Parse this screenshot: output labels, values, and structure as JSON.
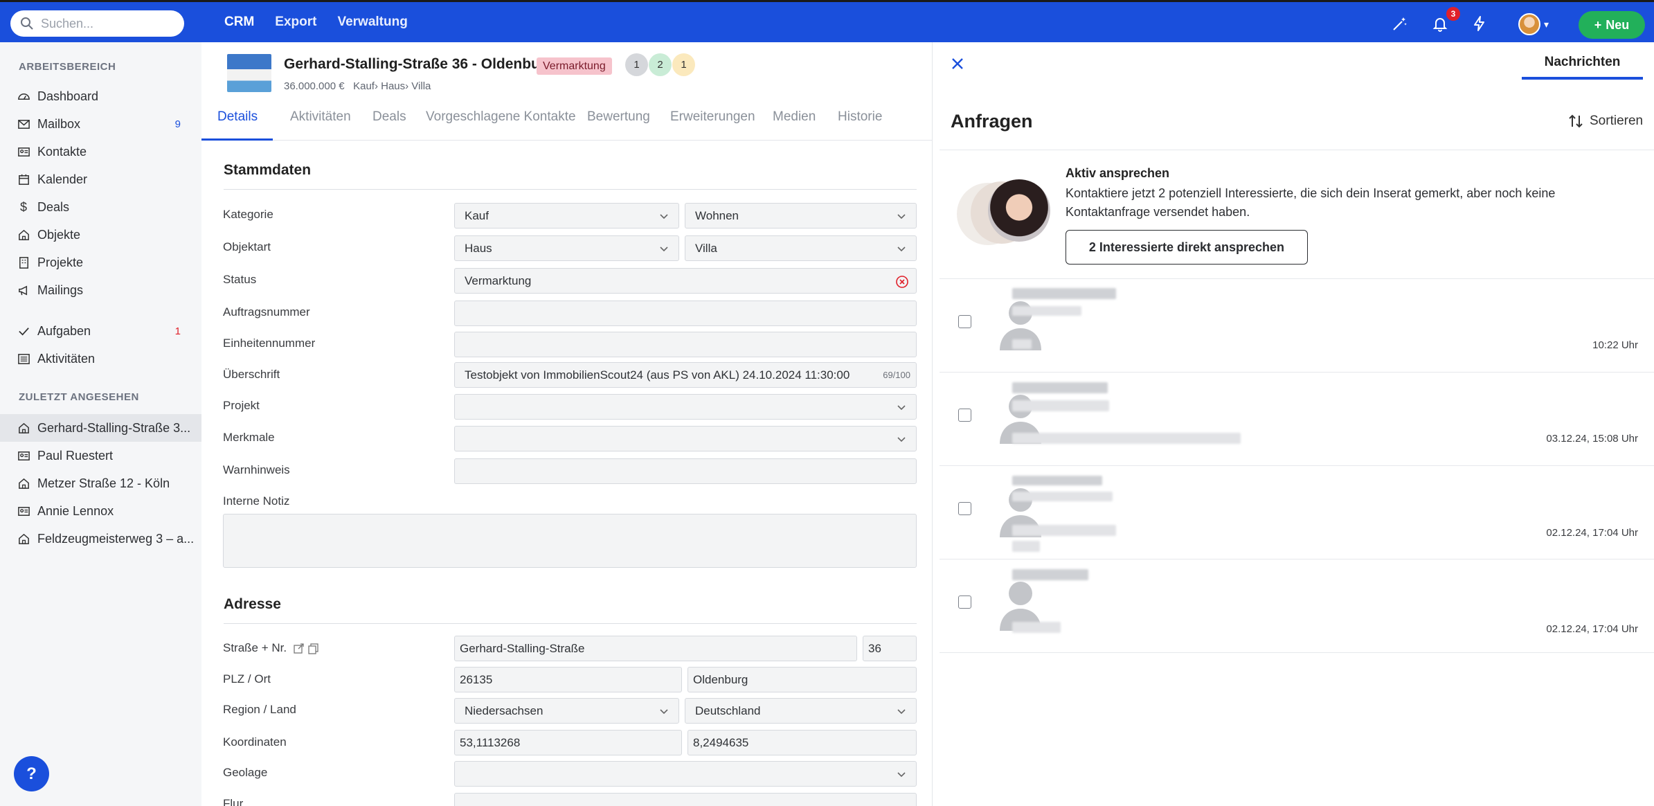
{
  "topbar": {
    "search_placeholder": "Suchen...",
    "nav": [
      "CRM",
      "Export",
      "Verwaltung"
    ],
    "notification_count": "3",
    "new_label": "Neu",
    "colors": {
      "primary": "#1a4fdc",
      "new_button": "#22b05a",
      "badge": "#e0202a"
    }
  },
  "sidebar": {
    "workspace_heading": "ARBEITSBEREICH",
    "items": [
      {
        "label": "Dashboard",
        "icon": "dashboard-icon",
        "count": ""
      },
      {
        "label": "Mailbox",
        "icon": "mail-icon",
        "count": "9"
      },
      {
        "label": "Kontakte",
        "icon": "contact-card-icon",
        "count": ""
      },
      {
        "label": "Kalender",
        "icon": "calendar-icon",
        "count": ""
      },
      {
        "label": "Deals",
        "icon": "dollar-icon",
        "count": ""
      },
      {
        "label": "Objekte",
        "icon": "house-icon",
        "count": ""
      },
      {
        "label": "Projekte",
        "icon": "building-icon",
        "count": ""
      },
      {
        "label": "Mailings",
        "icon": "megaphone-icon",
        "count": ""
      }
    ],
    "tasks": [
      {
        "label": "Aufgaben",
        "icon": "check-icon",
        "count": "1"
      },
      {
        "label": "Aktivitäten",
        "icon": "list-icon",
        "count": ""
      }
    ],
    "recent_heading": "ZULETZT ANGESEHEN",
    "recent": [
      {
        "label": "Gerhard-Stalling-Straße 3...",
        "icon": "house-icon"
      },
      {
        "label": "Paul Ruestert",
        "icon": "contact-card-icon"
      },
      {
        "label": "Metzer Straße 12 - Köln",
        "icon": "house-icon"
      },
      {
        "label": "Annie Lennox",
        "icon": "contact-card-icon"
      },
      {
        "label": "Feldzeugmeisterweg 3 – a...",
        "icon": "house-icon"
      }
    ],
    "help_label": "?"
  },
  "property": {
    "title": "Gerhard-Stalling-Straße 36 - Oldenburg",
    "status_badge": "Vermarktung",
    "counters": [
      "1",
      "2",
      "1"
    ],
    "price": "36.000.000 €",
    "breadcrumb": "Kauf› Haus› Villa",
    "tabs": [
      "Details",
      "Aktivitäten",
      "Deals",
      "Vorgeschlagene Kontakte",
      "Bewertung",
      "Erweiterungen",
      "Medien",
      "Historie"
    ],
    "active_tab": "Details"
  },
  "stammdaten": {
    "heading": "Stammdaten",
    "kategorie": {
      "label": "Kategorie",
      "value1": "Kauf",
      "value2": "Wohnen"
    },
    "objektart": {
      "label": "Objektart",
      "value1": "Haus",
      "value2": "Villa"
    },
    "status": {
      "label": "Status",
      "value": "Vermarktung"
    },
    "auftragsnummer": {
      "label": "Auftragsnummer",
      "value": ""
    },
    "einheitennummer": {
      "label": "Einheitennummer",
      "value": ""
    },
    "ueberschrift": {
      "label": "Überschrift",
      "value": "Testobjekt von ImmobilienScout24 (aus PS von AKL) 24.10.2024 11:30:00",
      "counter": "69/100"
    },
    "projekt": {
      "label": "Projekt",
      "value": ""
    },
    "merkmale": {
      "label": "Merkmale",
      "value": ""
    },
    "warnhinweis": {
      "label": "Warnhinweis",
      "value": ""
    },
    "interne_notiz": {
      "label": "Interne Notiz",
      "value": ""
    }
  },
  "adresse": {
    "heading": "Adresse",
    "strasse": {
      "label": "Straße + Nr.",
      "street": "Gerhard-Stalling-Straße",
      "number": "36"
    },
    "plz_ort": {
      "label": "PLZ / Ort",
      "plz": "26135",
      "ort": "Oldenburg"
    },
    "region_land": {
      "label": "Region / Land",
      "region": "Niedersachsen",
      "land": "Deutschland"
    },
    "koordinaten": {
      "label": "Koordinaten",
      "lat": "53,1113268",
      "lng": "8,2494635"
    },
    "geolage": {
      "label": "Geolage",
      "value": ""
    },
    "flur": {
      "label": "Flur"
    }
  },
  "panel": {
    "tab": "Nachrichten",
    "title": "Anfragen",
    "sort_label": "Sortieren",
    "promo": {
      "title": "Aktiv ansprechen",
      "text": "Kontaktiere jetzt 2 potenziell Interessierte, die sich dein Inserat gemerkt, aber noch keine Kontaktanfrage versendet haben.",
      "button": "2 Interessierte direkt ansprechen"
    },
    "inquiries": [
      {
        "time": "10:22 Uhr"
      },
      {
        "time": "03.12.24, 15:08 Uhr"
      },
      {
        "time": "02.12.24, 17:04 Uhr"
      },
      {
        "time": "02.12.24, 17:04 Uhr"
      }
    ]
  }
}
